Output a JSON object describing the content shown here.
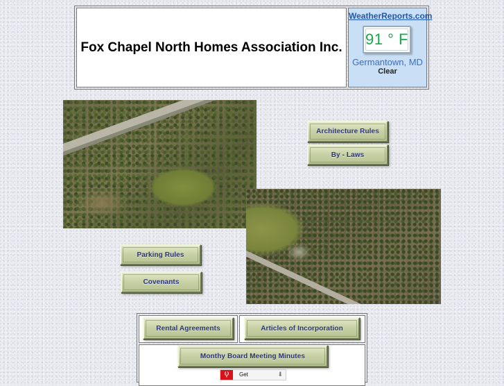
{
  "header": {
    "title": "Fox Chapel North Homes Association Inc."
  },
  "weather": {
    "site": "WeatherReports.com",
    "temperature": "91 ° F",
    "city": "Germantown, MD",
    "condition": "Clear"
  },
  "nav": {
    "architecture_rules": "Architecture Rules",
    "by_laws": "By - Laws",
    "parking_rules": "Parking Rules",
    "covenants": "Covenants",
    "rental_agreements": "Rental Agreements",
    "articles": "Articles of Incorporation",
    "minutes": "Monthy Board Meeting Minutes"
  },
  "widget": {
    "text": "Get"
  },
  "colors": {
    "weather_bg": "#c9dff6",
    "temp_green": "#17a84b",
    "button_text": "#2b347a"
  }
}
